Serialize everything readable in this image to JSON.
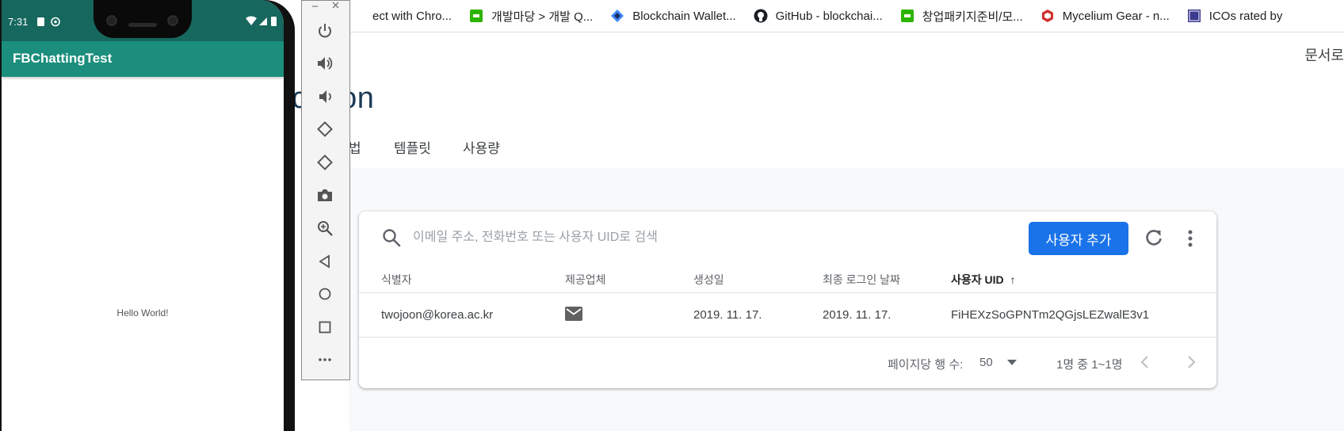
{
  "bookmarks": [
    {
      "label": "ect with Chro...",
      "icon": "none-icon"
    },
    {
      "label": "개발마당 > 개발 Q...",
      "icon": "bookmark-green-icon"
    },
    {
      "label": "Blockchain Wallet...",
      "icon": "blockchain-icon"
    },
    {
      "label": "GitHub - blockchai...",
      "icon": "github-icon"
    },
    {
      "label": "창업패키지준비/모...",
      "icon": "bookmark-green-icon"
    },
    {
      "label": "Mycelium Gear - n...",
      "icon": "mycelium-icon"
    },
    {
      "label": "ICOs rated by",
      "icon": "ico-icon"
    }
  ],
  "page": {
    "docs_link": "문서로",
    "title_fragment": "cation",
    "tab_partial": "법",
    "tabs": [
      "템플릿",
      "사용량"
    ]
  },
  "users": {
    "search_placeholder": "이메일 주소, 전화번호 또는 사용자 UID로 검색",
    "add_button": "사용자 추가",
    "columns": [
      "식별자",
      "제공업체",
      "생성일",
      "최종 로그인 날짜",
      "사용자 UID"
    ],
    "sort_arrow": "↑",
    "rows": [
      {
        "identifier": "twojoon@korea.ac.kr",
        "provider": "email-icon",
        "created": "2019. 11. 17.",
        "last_login": "2019. 11. 17.",
        "uid": "FiHEXzSoGPNTm2QGjsLEZwalE3v1"
      }
    ],
    "rows_per_page_label": "페이지당 행 수:",
    "rows_per_page": "50",
    "range": "1명 중 1~1명"
  },
  "phone": {
    "time": "7:31",
    "app_title": "FBChattingTest",
    "content": "Hello World!"
  },
  "emulator": {
    "buttons": [
      "power-icon",
      "volume-up-icon",
      "volume-down-icon",
      "rotate-left-icon",
      "rotate-right-icon",
      "camera-icon",
      "zoom-icon",
      "back-icon",
      "home-icon",
      "overview-icon",
      "more-icon"
    ]
  },
  "colors": {
    "accent": "#1a73e8",
    "appbar": "#1b8e7d",
    "statusbar": "#16675d"
  }
}
